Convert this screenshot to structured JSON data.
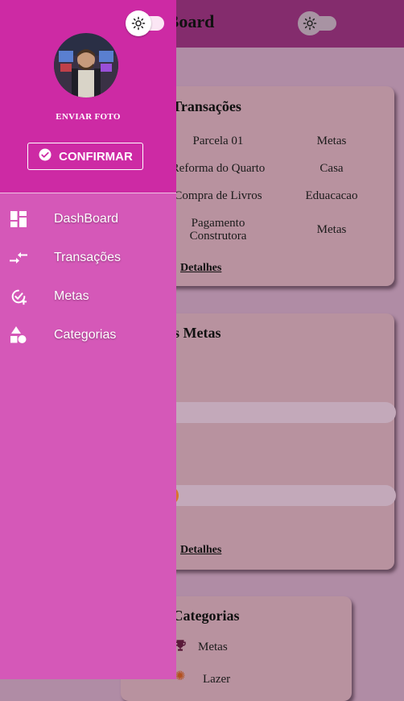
{
  "header": {
    "title": "DashBoard"
  },
  "drawer": {
    "upload_label": "ENVIAR FOTO",
    "confirm_label": "CONFIRMAR",
    "nav": [
      {
        "label": "DashBoard",
        "icon": "dashboard-icon"
      },
      {
        "label": "Transações",
        "icon": "transactions-icon"
      },
      {
        "label": "Metas",
        "icon": "goals-icon"
      },
      {
        "label": "Categorias",
        "icon": "categories-icon"
      }
    ]
  },
  "transactions_card": {
    "title": "Últimas Transações",
    "rows": [
      {
        "name": "Parcela 01",
        "category": "Metas"
      },
      {
        "name": "Reforma do Quarto",
        "category": "Casa"
      },
      {
        "name": "Compra de Livros",
        "category": "Eduacacao"
      },
      {
        "name": "Pagamento Construtora",
        "category": "Metas"
      }
    ],
    "details_label": "Detalhes"
  },
  "goals_card": {
    "title": "Próximas Metas",
    "details_label": "Detalhes"
  },
  "categories_card": {
    "title": "Últimas Categorias",
    "items": [
      {
        "label": "Metas",
        "icon": "trophy-icon"
      },
      {
        "label": "Lazer",
        "icon": "leisure-icon"
      }
    ]
  },
  "colors": {
    "drawer_header": "#cd2aa4",
    "drawer_body": "#d558b8",
    "app_header": "#842c6d",
    "backdrop": "#b08ca5"
  }
}
